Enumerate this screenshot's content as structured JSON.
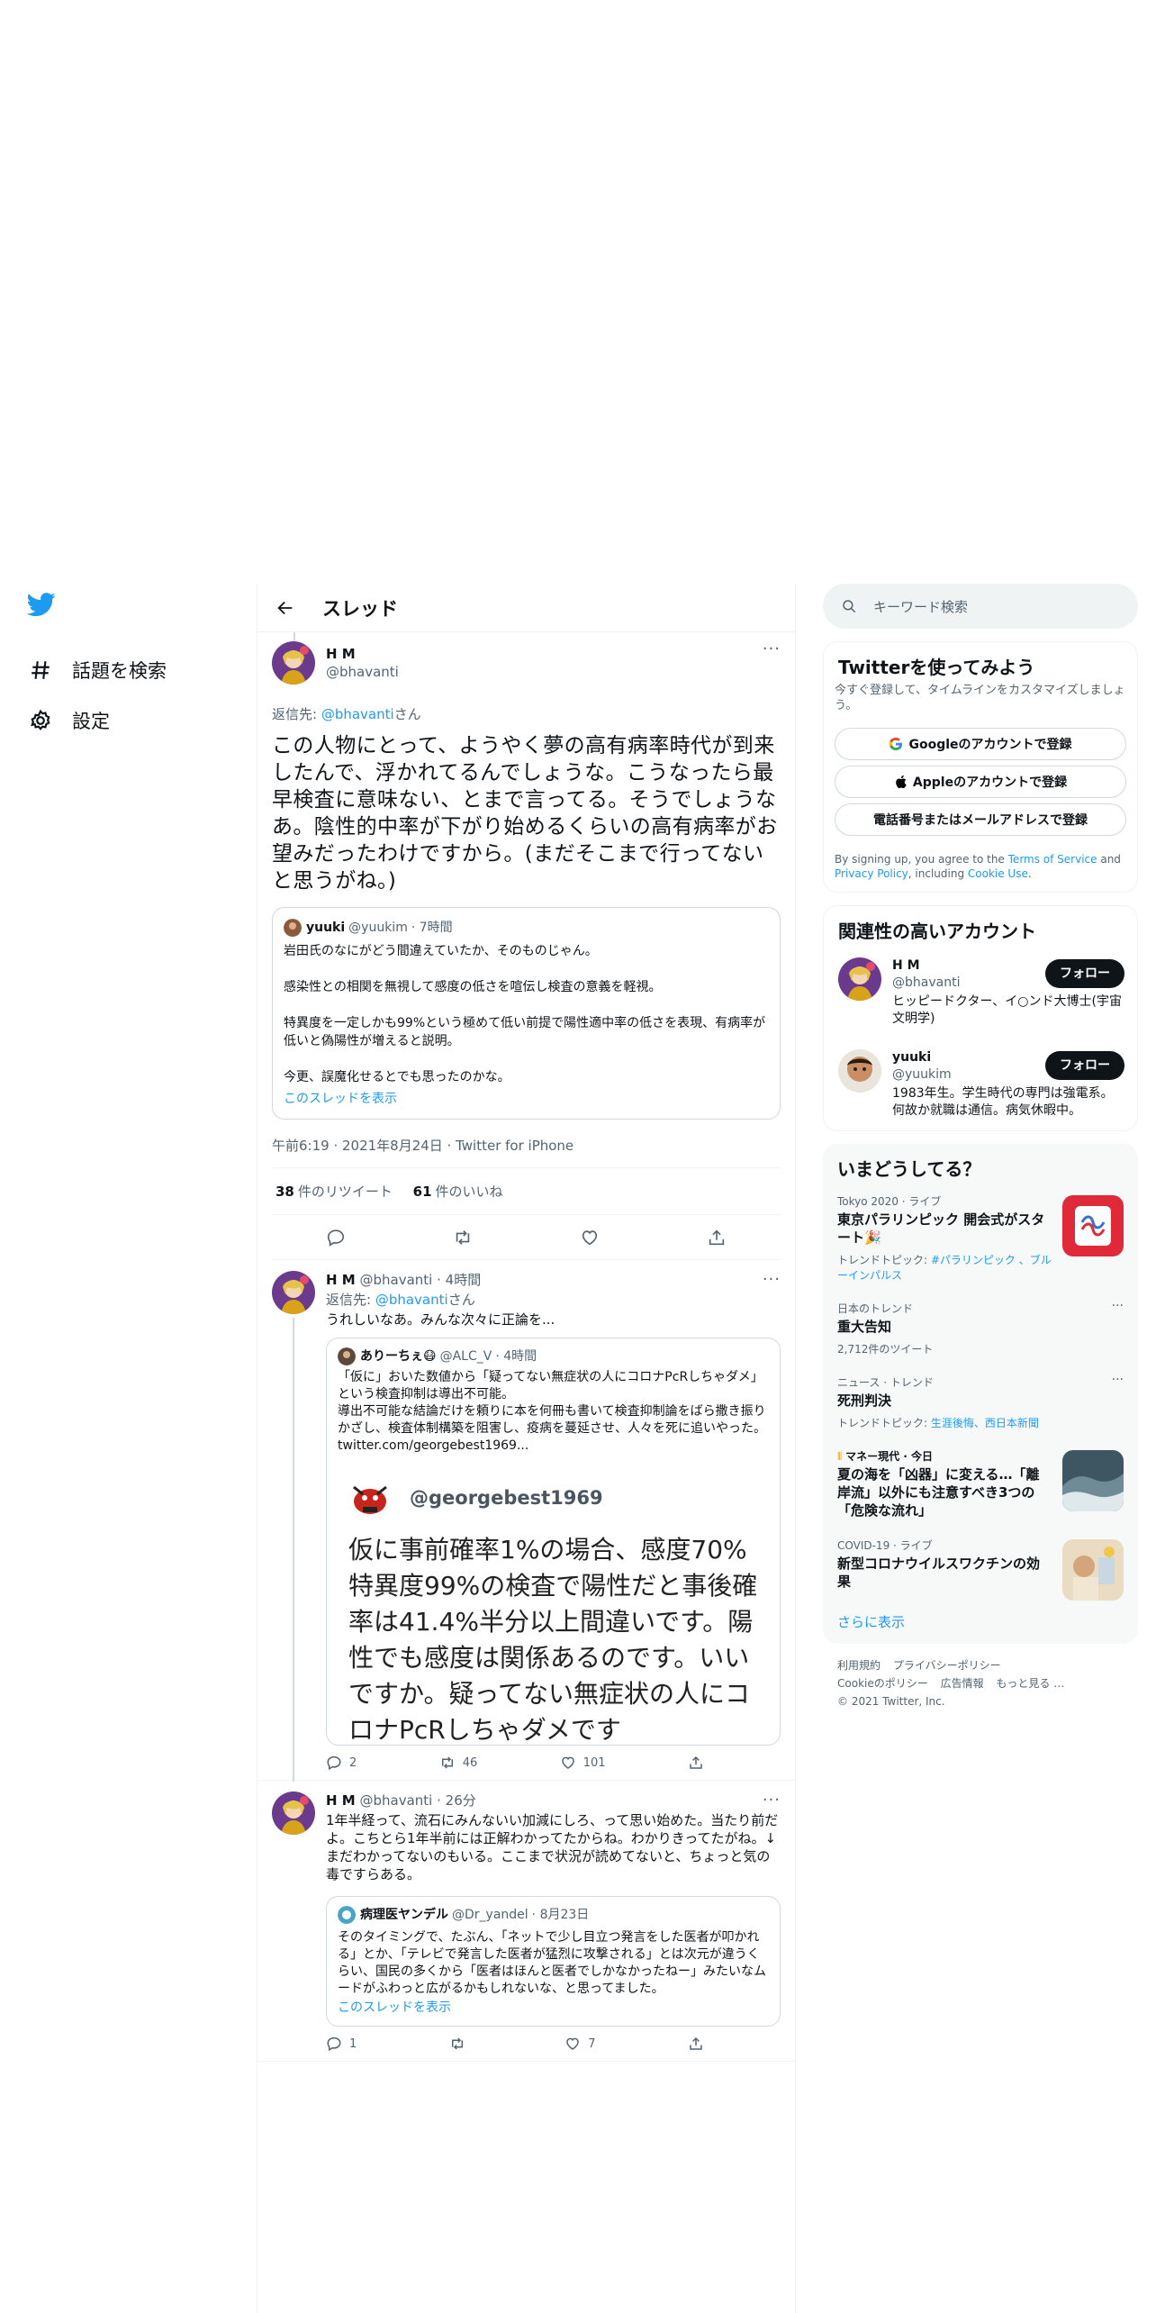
{
  "nav": {
    "items": [
      {
        "label": "話題を検索",
        "icon": "hashtag-icon"
      },
      {
        "label": "設定",
        "icon": "gear-icon"
      }
    ]
  },
  "header": {
    "title": "スレッド"
  },
  "focus_tweet": {
    "name": "H M",
    "handle": "@bhavanti",
    "reply_prefix": "返信先: ",
    "reply_to": "@bhavanti",
    "reply_suffix": "さん",
    "text": "この人物にとって、ようやく夢の高有病率時代が到来したんで、浮かれてるんでしょうな。こうなったら最早検査に意味ない、とまで言ってる。そうでしょうなあ。陰性的中率が下がり始めるくらいの高有病率がお望みだったわけですから。(まだそこまで行ってないと思うがね。)",
    "quote": {
      "name": "yuuki",
      "handle": "@yuukim",
      "time": "· 7時間",
      "paragraphs": [
        "岩田氏のなにがどう間違えていたか、そのものじゃん。",
        "感染性との相関を無視して感度の低さを喧伝し検査の意義を軽視。",
        "特異度を一定しかも99%という極めて低い前提で陽性適中率の低さを表現、有病率が低いと偽陽性が増えると説明。",
        "今更、誤魔化せるとでも思ったのかな。"
      ],
      "show_thread": "このスレッドを表示"
    },
    "meta": "午前6:19 · 2021年8月24日 · Twitter for iPhone",
    "retweets": "38",
    "retweets_label": "件のリツイート",
    "likes": "61",
    "likes_label": "件のいいね"
  },
  "replies": [
    {
      "name": "H M",
      "handle": "@bhavanti",
      "time": "· 4時間",
      "reply_prefix": "返信先: ",
      "reply_to": "@bhavanti",
      "reply_suffix": "さん",
      "text": "うれしいなあ。みんな次々に正論を...",
      "quote": {
        "name": "ありーちぇ😷",
        "handle": "@ALC_V",
        "time": "· 4時間",
        "text": "「仮に」おいた数値から「疑ってない無症状の人にコロナPcRしちゃダメ」という検査抑制は導出不可能。\n導出不可能な結論だけを頼りに本を何冊も書いて検査抑制論をばら撒き振りかざし、検査体制構築を阻害し、疫病を蔓延させ、人々を死に追いやった。",
        "link": "twitter.com/georgebest1969...",
        "image_handle": "@georgebest1969",
        "image_text": "仮に事前確率1%の場合、感度70%特異度99%の検査で陽性だと事後確率は41.4%半分以上間違いです。陽性でも感度は関係あるのです。いいですか。疑ってない無症状の人にコロナPcRしちゃダメです"
      },
      "replies": "2",
      "retweets": "46",
      "likes": "101"
    },
    {
      "name": "H M",
      "handle": "@bhavanti",
      "time": "· 26分",
      "text": "1年半経って、流石にみんないい加減にしろ、って思い始めた。当たり前だよ。こちとら1年半前には正解わかってたからね。わかりきってたがね。↓まだわかってないのもいる。ここまで状況が読めてないと、ちょっと気の毒ですらある。",
      "quote": {
        "name": "病理医ヤンデル",
        "handle": "@Dr_yandel",
        "time": "· 8月23日",
        "text": "そのタイミングで、たぶん、「ネットで少し目立つ発言をした医者が叩かれる」とか、「テレビで発言した医者が猛烈に攻撃される」とは次元が違うくらい、国民の多くから「医者はほんと医者でしかなかったねー」みたいなムードがふわっと広がるかもしれないな、と思ってました。",
        "show_thread": "このスレッドを表示"
      },
      "replies": "1",
      "retweets": "",
      "likes": "7"
    }
  ],
  "search": {
    "placeholder": "キーワード検索"
  },
  "signup": {
    "title": "Twitterを使ってみよう",
    "desc": "今すぐ登録して、タイムラインをカスタマイズしましょう。",
    "google": "Googleのアカウントで登録",
    "apple": "Appleのアカウントで登録",
    "phone": "電話番号またはメールアドレスで登録",
    "legal_1": "By signing up, you agree to the ",
    "terms": "Terms of Service",
    "legal_2": " and ",
    "privacy": "Privacy Policy",
    "legal_3": ", including ",
    "cookie": "Cookie Use",
    "legal_4": "."
  },
  "related": {
    "title": "関連性の高いアカウント",
    "follow_label": "フォロー",
    "accounts": [
      {
        "name": "H M",
        "handle": "@bhavanti",
        "bio": "ヒッピードクター、イ○ンド大博士(宇宙文明学)"
      },
      {
        "name": "yuuki",
        "handle": "@yuukim",
        "bio": "1983年生。学生時代の専門は強電系。何故か就職は通信。病気休暇中。"
      }
    ]
  },
  "trends": {
    "title": "いまどうしてる？",
    "items": [
      {
        "ctx": "Tokyo 2020 · ライブ",
        "title": "東京パラリンピック 開会式がスタート🎉",
        "sub_prefix": "トレンドトピック: ",
        "sub_links": "#パラリンピック 、ブルーインパルス"
      },
      {
        "ctx": "日本のトレンド",
        "title": "重大告知",
        "sub": "2,712件のツイート"
      },
      {
        "ctx": "ニュース · トレンド",
        "title": "死刑判決",
        "sub_prefix": "トレンドトピック: ",
        "sub_links": "生涯後悔、西日本新聞"
      },
      {
        "ctx": "マネー現代 · 今日",
        "title": "夏の海を「凶器」に変える…「離岸流」以外にも注意すべき3つの「危険な流れ」"
      },
      {
        "ctx": "COVID-19 · ライブ",
        "title": "新型コロナウイルスワクチンの効果"
      }
    ],
    "show_more": "さらに表示"
  },
  "footer": {
    "links": [
      "利用規約",
      "プライバシーポリシー",
      "Cookieのポリシー",
      "広告情報",
      "もっと見る …"
    ],
    "copyright": "© 2021 Twitter, Inc."
  },
  "colors": {
    "accent": "#1d9bf0",
    "text": "#0f1419",
    "muted": "#536471"
  }
}
